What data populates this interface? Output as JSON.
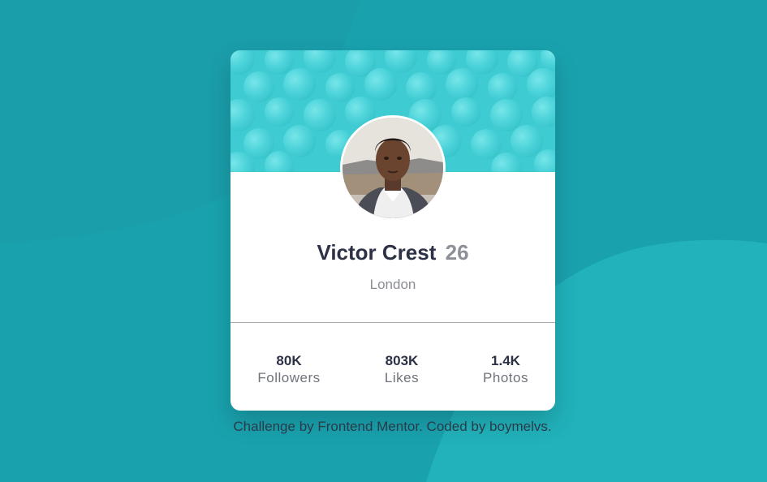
{
  "colors": {
    "background": "#19a2ae",
    "background_shape": "#21b2bb",
    "banner": "#42cfd6",
    "name": "#2c3145",
    "muted": "#8a8d94"
  },
  "profile": {
    "name": "Victor Crest",
    "age": "26",
    "location": "London",
    "avatar_icon": "profile-photo"
  },
  "stats": [
    {
      "value": "80K",
      "label": "Followers"
    },
    {
      "value": "803K",
      "label": "Likes"
    },
    {
      "value": "1.4K",
      "label": "Photos"
    }
  ],
  "footer": {
    "attribution": "Challenge by Frontend Mentor. Coded by boymelvs."
  }
}
